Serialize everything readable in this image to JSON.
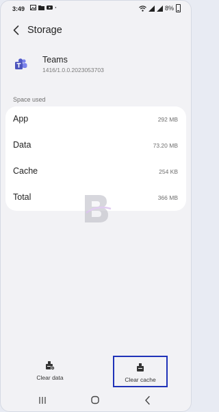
{
  "status_bar": {
    "time": "3:49",
    "battery_percent": "8%",
    "left_icons": [
      "gallery-icon",
      "folder-icon",
      "youtube-icon",
      "dot-icon"
    ],
    "right_icons": [
      "wifi-icon",
      "signal-icon",
      "signal-icon",
      "battery-icon"
    ]
  },
  "app_bar": {
    "title": "Storage",
    "back_icon": "chevron-left-icon"
  },
  "app": {
    "name": "Teams",
    "version": "1416/1.0.0.2023053703",
    "icon": "teams-icon"
  },
  "storage": {
    "section_label": "Space used",
    "rows": [
      {
        "label": "App",
        "value": "292 MB"
      },
      {
        "label": "Data",
        "value": "73.20 MB"
      },
      {
        "label": "Cache",
        "value": "254 KB"
      },
      {
        "label": "Total",
        "value": "366 MB"
      }
    ]
  },
  "actions": {
    "clear_data": {
      "label": "Clear data",
      "icon": "clear-data-icon"
    },
    "clear_cache": {
      "label": "Clear cache",
      "icon": "clear-cache-icon"
    }
  },
  "colors": {
    "highlight_border": "#1f32b8",
    "background": "#f2f2f5",
    "card": "#ffffff"
  },
  "nav_bar": {
    "icons": [
      "recent-apps-icon",
      "home-icon",
      "back-icon"
    ]
  }
}
